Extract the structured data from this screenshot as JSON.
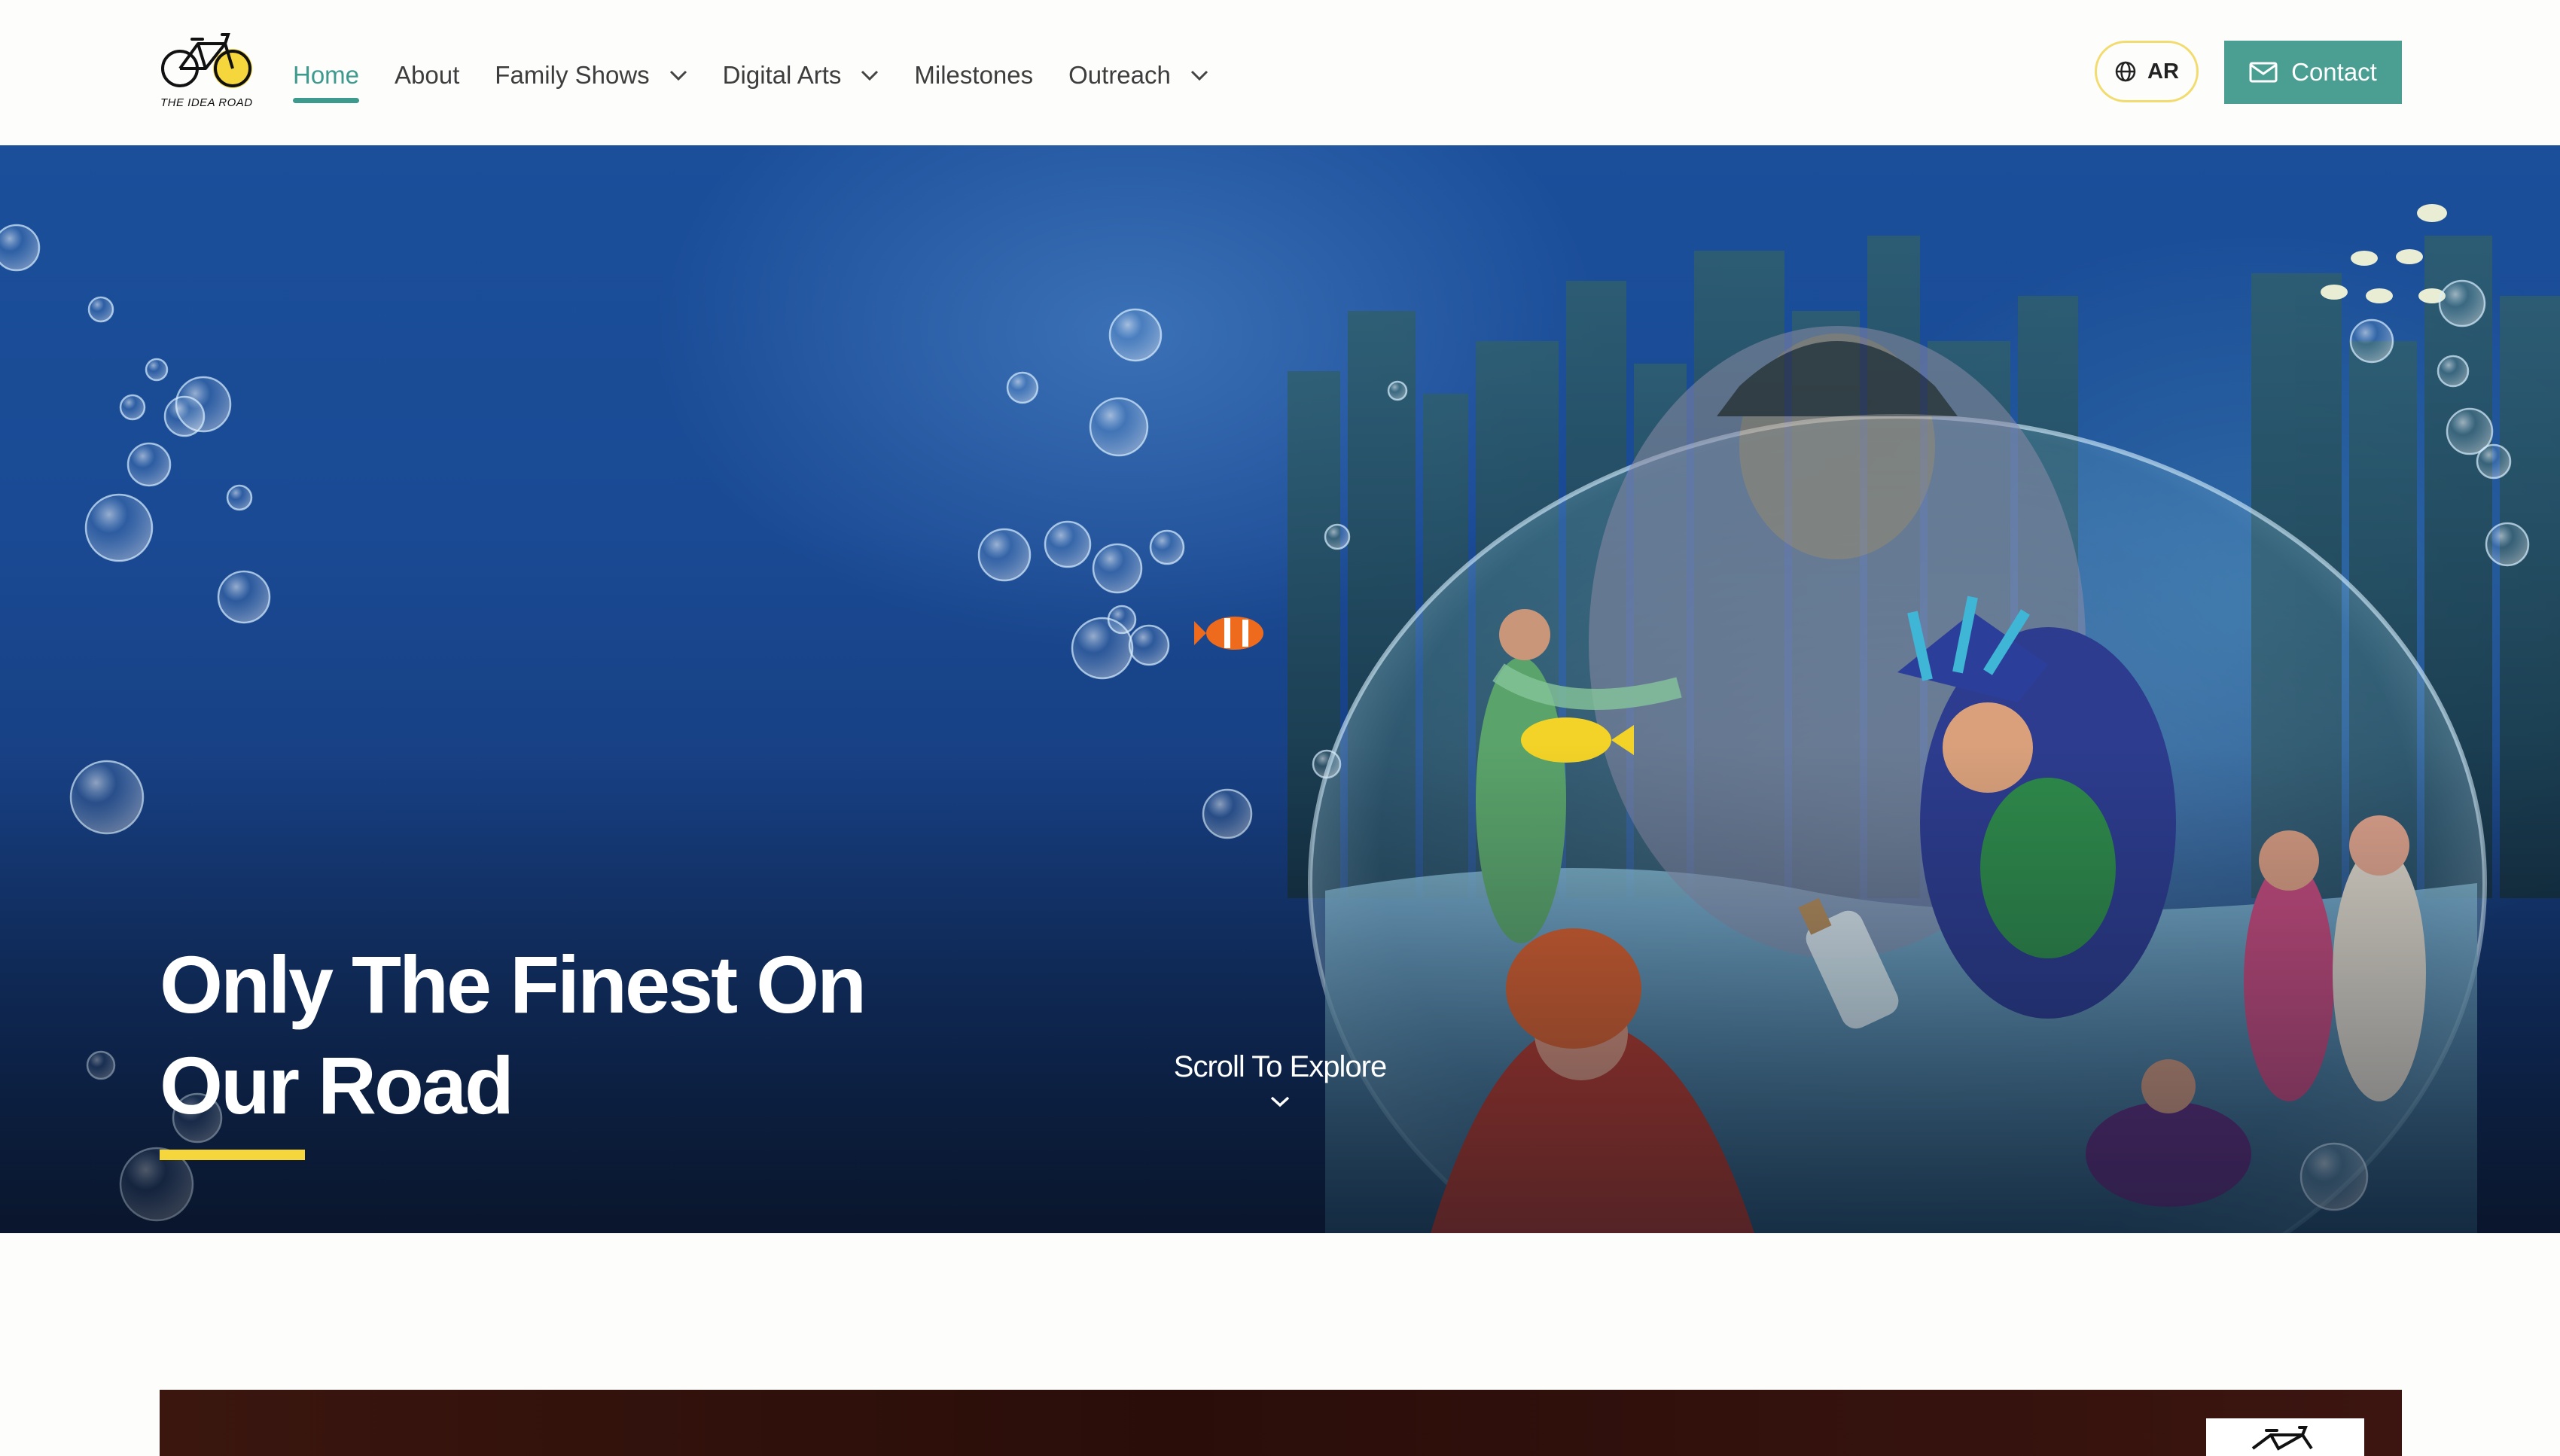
{
  "brand": {
    "logo_text": "THE IDEA ROAD",
    "colors": {
      "accent_teal": "#4a9f92",
      "accent_yellow": "#f5d63d",
      "lang_border": "#f2dc70"
    }
  },
  "nav": {
    "items": [
      {
        "label": "Home",
        "active": true,
        "has_dropdown": false
      },
      {
        "label": "About",
        "active": false,
        "has_dropdown": false
      },
      {
        "label": "Family Shows",
        "active": false,
        "has_dropdown": true
      },
      {
        "label": "Digital Arts",
        "active": false,
        "has_dropdown": true
      },
      {
        "label": "Milestones",
        "active": false,
        "has_dropdown": false
      },
      {
        "label": "Outreach",
        "active": false,
        "has_dropdown": true
      }
    ]
  },
  "header_actions": {
    "language_label": "AR",
    "language_icon": "globe-icon",
    "contact_label": "Contact",
    "contact_icon": "mail-icon"
  },
  "hero": {
    "title": "Only The Finest On Our Road",
    "scroll_label": "Scroll To Explore",
    "scroll_icon": "chevron-down-icon"
  }
}
